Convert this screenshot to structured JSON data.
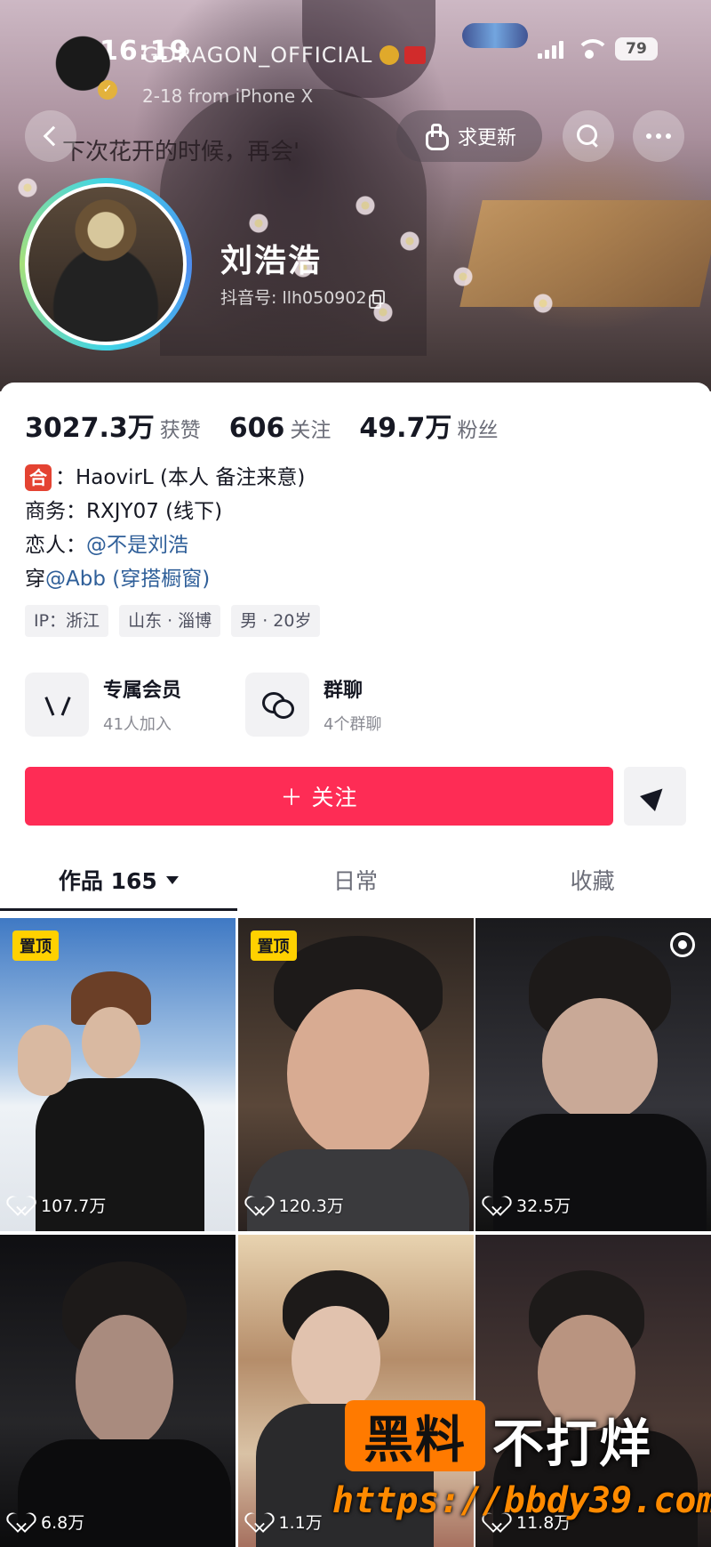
{
  "status_bar": {
    "time": "16:19",
    "battery": "79"
  },
  "post_overlay": {
    "account_name": "GDRAGON_OFFICIAL",
    "meta": "2-18  from iPhone X",
    "caption": "下次花开的时候，再会'"
  },
  "header": {
    "update_label": "求更新"
  },
  "profile": {
    "name": "刘浩浩",
    "douyin_id": "抖音号: llh050902"
  },
  "stats": [
    {
      "value": "3027.3万",
      "label": "获赞"
    },
    {
      "value": "606",
      "label": "关注"
    },
    {
      "value": "49.7万",
      "label": "粉丝"
    }
  ],
  "bio": {
    "line1_badge": "合",
    "line1": "：HaovirL (本人 备注来意)",
    "line2": "商务：RXJY07 (线下)",
    "line3_prefix": "恋人：",
    "line3_link": "@不是刘浩",
    "line4_prefix": "穿",
    "line4_link": "@Abb (穿搭橱窗)"
  },
  "tags": [
    "IP：浙江",
    "山东 · 淄博",
    "男 · 20岁"
  ],
  "features": [
    {
      "title": "专属会员",
      "sub": "41人加入",
      "icon": "v-icon"
    },
    {
      "title": "群聊",
      "sub": "4个群聊",
      "icon": "group-chat-icon"
    }
  ],
  "follow_label": "＋ 关注",
  "tabs": [
    {
      "label": "作品 165",
      "active": true
    },
    {
      "label": "日常",
      "active": false
    },
    {
      "label": "收藏",
      "active": false
    }
  ],
  "grid": [
    {
      "likes": "107.7万",
      "pinned": true,
      "pin_label": "置顶"
    },
    {
      "likes": "120.3万",
      "pinned": true,
      "pin_label": "置顶"
    },
    {
      "likes": "32.5万",
      "pinned": false
    },
    {
      "likes": "6.8万",
      "pinned": false
    },
    {
      "likes": "1.1万",
      "pinned": false
    },
    {
      "likes": "11.8万",
      "pinned": false
    }
  ],
  "watermark": {
    "box": "黑料",
    "text": "不打烊",
    "url": "https://bbdy39.com"
  },
  "colors": {
    "accent": "#fe2c55",
    "pin": "#ffd100",
    "link": "#2f5f99",
    "watermark": "#ff7a00"
  }
}
